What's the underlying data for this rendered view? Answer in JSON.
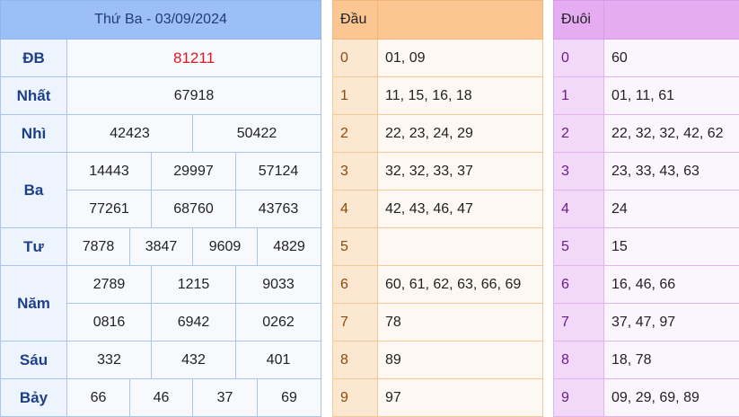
{
  "results": {
    "title": "Thứ Ba - 03/09/2024",
    "rows": [
      {
        "label": "ĐB",
        "values": [
          "81211"
        ]
      },
      {
        "label": "Nhất",
        "values": [
          "67918"
        ]
      },
      {
        "label": "Nhì",
        "values": [
          "42423",
          "50422"
        ]
      },
      {
        "label": "Ba",
        "values": [
          "14443",
          "29997",
          "57124",
          "77261",
          "68760",
          "43763"
        ]
      },
      {
        "label": "Tư",
        "values": [
          "7878",
          "3847",
          "9609",
          "4829"
        ]
      },
      {
        "label": "Năm",
        "values": [
          "2789",
          "1215",
          "9033",
          "0816",
          "6942",
          "0262"
        ]
      },
      {
        "label": "Sáu",
        "values": [
          "332",
          "432",
          "401"
        ]
      },
      {
        "label": "Bảy",
        "values": [
          "66",
          "46",
          "37",
          "69"
        ]
      }
    ]
  },
  "head": {
    "title": "Đầu",
    "rows": [
      {
        "digit": "0",
        "values": "01, 09"
      },
      {
        "digit": "1",
        "values": "11, 15, 16, 18"
      },
      {
        "digit": "2",
        "values": "22, 23, 24, 29"
      },
      {
        "digit": "3",
        "values": "32, 32, 33, 37"
      },
      {
        "digit": "4",
        "values": "42, 43, 46, 47"
      },
      {
        "digit": "5",
        "values": ""
      },
      {
        "digit": "6",
        "values": "60, 61, 62, 63, 66, 69"
      },
      {
        "digit": "7",
        "values": "78"
      },
      {
        "digit": "8",
        "values": "89"
      },
      {
        "digit": "9",
        "values": "97"
      }
    ]
  },
  "tail": {
    "title": "Đuôi",
    "rows": [
      {
        "digit": "0",
        "values": "60"
      },
      {
        "digit": "1",
        "values": "01, 11, 61"
      },
      {
        "digit": "2",
        "values": "22, 32, 32, 42, 62"
      },
      {
        "digit": "3",
        "values": "23, 33, 43, 63"
      },
      {
        "digit": "4",
        "values": "24"
      },
      {
        "digit": "5",
        "values": "15"
      },
      {
        "digit": "6",
        "values": "16, 46, 66"
      },
      {
        "digit": "7",
        "values": "37, 47, 97"
      },
      {
        "digit": "8",
        "values": "18, 78"
      },
      {
        "digit": "9",
        "values": "09, 29, 69, 89"
      }
    ]
  },
  "colors": {
    "special_prize": "#e0161e",
    "results_header": "#9dbff7",
    "head_header": "#fbc692",
    "tail_header": "#e6acf2"
  }
}
